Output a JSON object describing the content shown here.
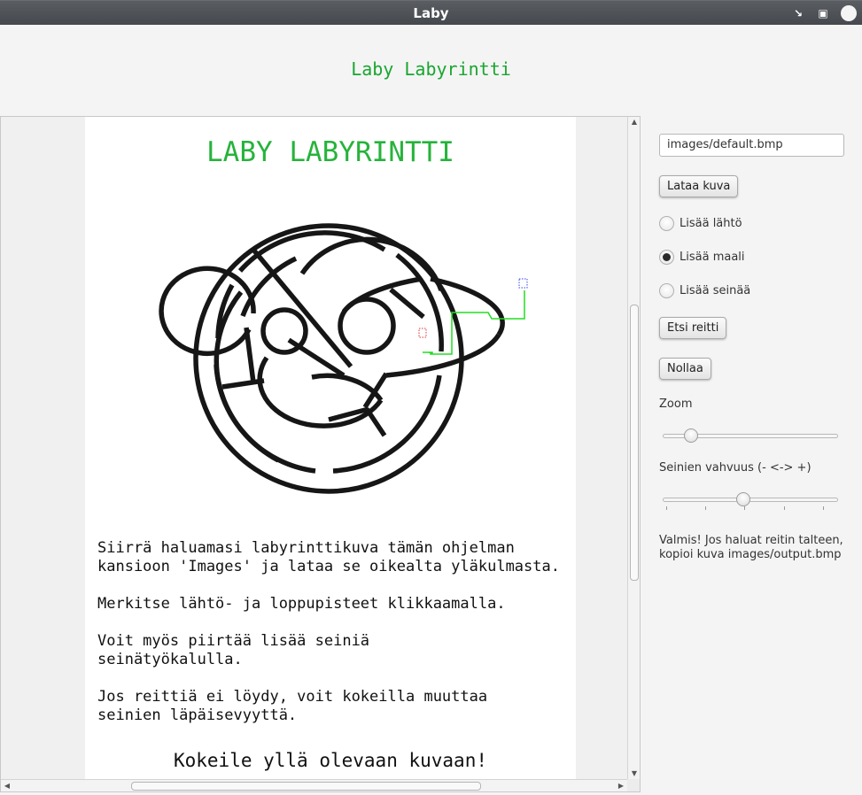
{
  "window": {
    "title": "Laby",
    "controls": [
      "minimize-icon",
      "maximize-icon",
      "close-icon"
    ]
  },
  "app": {
    "heading": "Laby Labyrintti"
  },
  "document": {
    "title": "LABY LABYRINTTI",
    "paragraphs": [
      [
        "Siirrä haluamasi labyrinttikuva tämän ohjelman",
        "kansioon 'Images' ja lataa se oikealta yläkulmasta."
      ],
      [
        "Merkitse lähtö- ja loppupisteet klikkaamalla."
      ],
      [
        "Voit myös piirtää lisää seiniä",
        "seinätyökalulla."
      ],
      [
        "Jos reittiä ei löydy, voit kokeilla muuttaa",
        "seinien läpäisevyyttä."
      ]
    ],
    "try_text": "Kokeile yllä olevaan kuvaan!"
  },
  "panel": {
    "file_path": "images/default.bmp",
    "load_button": "Lataa kuva",
    "radios": [
      {
        "label": "Lisää lähtö",
        "selected": false
      },
      {
        "label": "Lisää maali",
        "selected": true
      },
      {
        "label": "Lisää seinää",
        "selected": false
      }
    ],
    "search_button": "Etsi reitti",
    "reset_button": "Nollaa",
    "zoom_label": "Zoom",
    "zoom_value": 0.16,
    "wall_label": "Seinien vahvuus (- <-> +)",
    "wall_value": 0.46,
    "status_lines": [
      "Valmis! Jos haluat reitin talteen,",
      "kopioi kuva images/output.bmp"
    ]
  },
  "colors": {
    "accent_green": "#19a630",
    "route_green": "#22dd22",
    "start_marker": "#dd3333",
    "goal_marker": "#3344ee"
  }
}
